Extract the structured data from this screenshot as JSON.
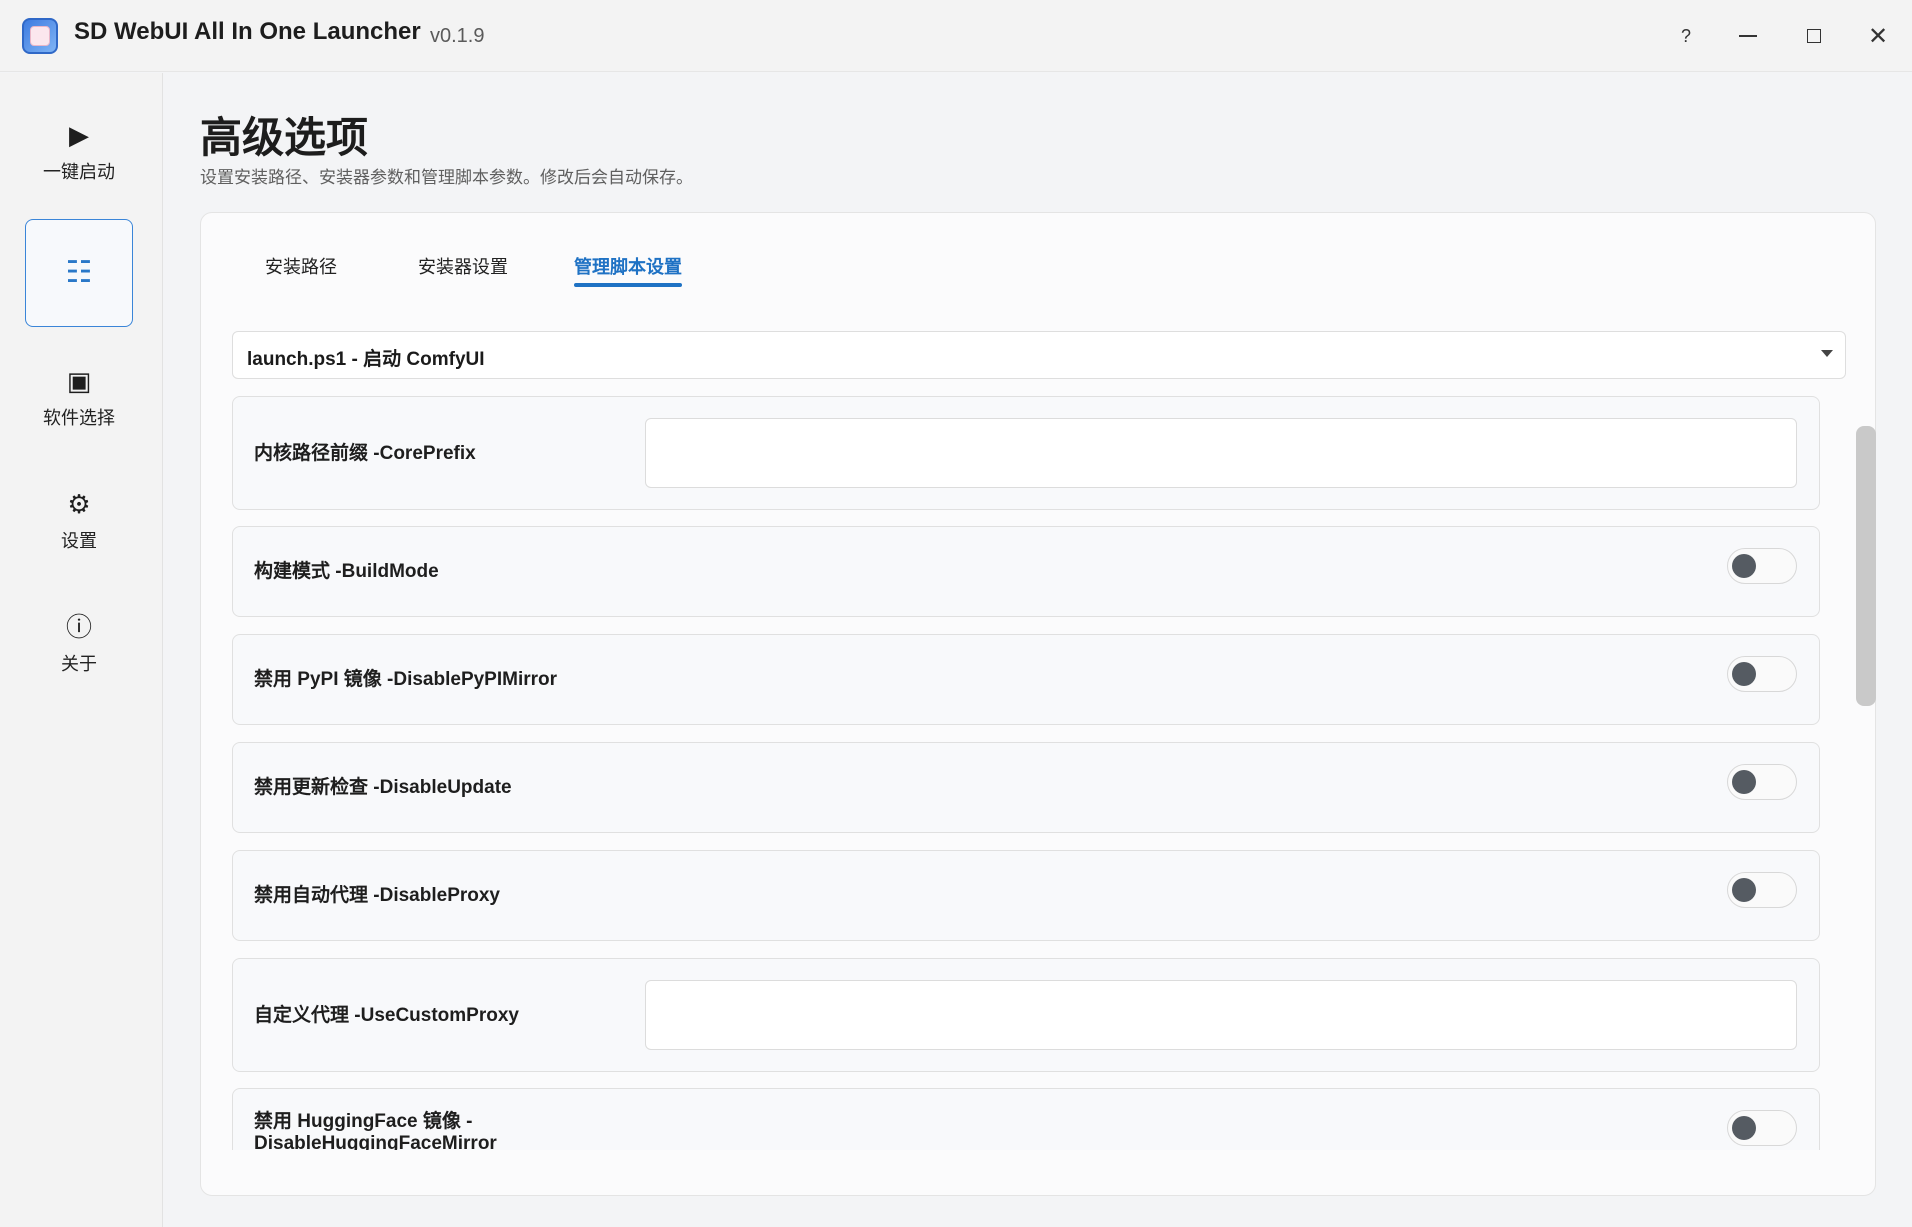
{
  "window": {
    "title": "SD WebUI All In One Launcher",
    "version": "v0.1.9",
    "help_label": "?",
    "close_label": "✕"
  },
  "sidebar": {
    "items": [
      {
        "label": "一键启动",
        "icon": "play-icon",
        "glyph": "▶"
      },
      {
        "label": "",
        "icon": "list-icon",
        "glyph": "☷"
      },
      {
        "label": "软件选择",
        "icon": "select-square-icon",
        "glyph": "▣"
      },
      {
        "label": "设置",
        "icon": "gear-icon",
        "glyph": "⚙"
      },
      {
        "label": "关于",
        "icon": "info-icon",
        "glyph": "ⓘ"
      }
    ],
    "active_index": 1
  },
  "page": {
    "title": "高级选项",
    "subtitle": "设置安装路径、安装器参数和管理脚本参数。修改后会自动保存。"
  },
  "tabs": [
    {
      "label": "安装路径"
    },
    {
      "label": "安装器设置"
    },
    {
      "label": "管理脚本设置"
    }
  ],
  "active_tab": 2,
  "script_select": {
    "value": "launch.ps1 - 启动 ComfyUI"
  },
  "options": [
    {
      "label": "内核路径前缀 -CorePrefix",
      "type": "text",
      "value": ""
    },
    {
      "label": "构建模式 -BuildMode",
      "type": "toggle",
      "on": false
    },
    {
      "label": "禁用 PyPI 镜像 -DisablePyPIMirror",
      "type": "toggle",
      "on": false
    },
    {
      "label": "禁用更新检查 -DisableUpdate",
      "type": "toggle",
      "on": false
    },
    {
      "label": "禁用自动代理 -DisableProxy",
      "type": "toggle",
      "on": false
    },
    {
      "label": "自定义代理 -UseCustomProxy",
      "type": "text",
      "value": ""
    },
    {
      "label_line1": "禁用 HuggingFace 镜像 -",
      "label_line2": "DisableHuggingFaceMirror",
      "type": "toggle",
      "on": false
    }
  ],
  "colors": {
    "accent": "#1f72c4",
    "toggle_knob_off": "#555b62"
  }
}
